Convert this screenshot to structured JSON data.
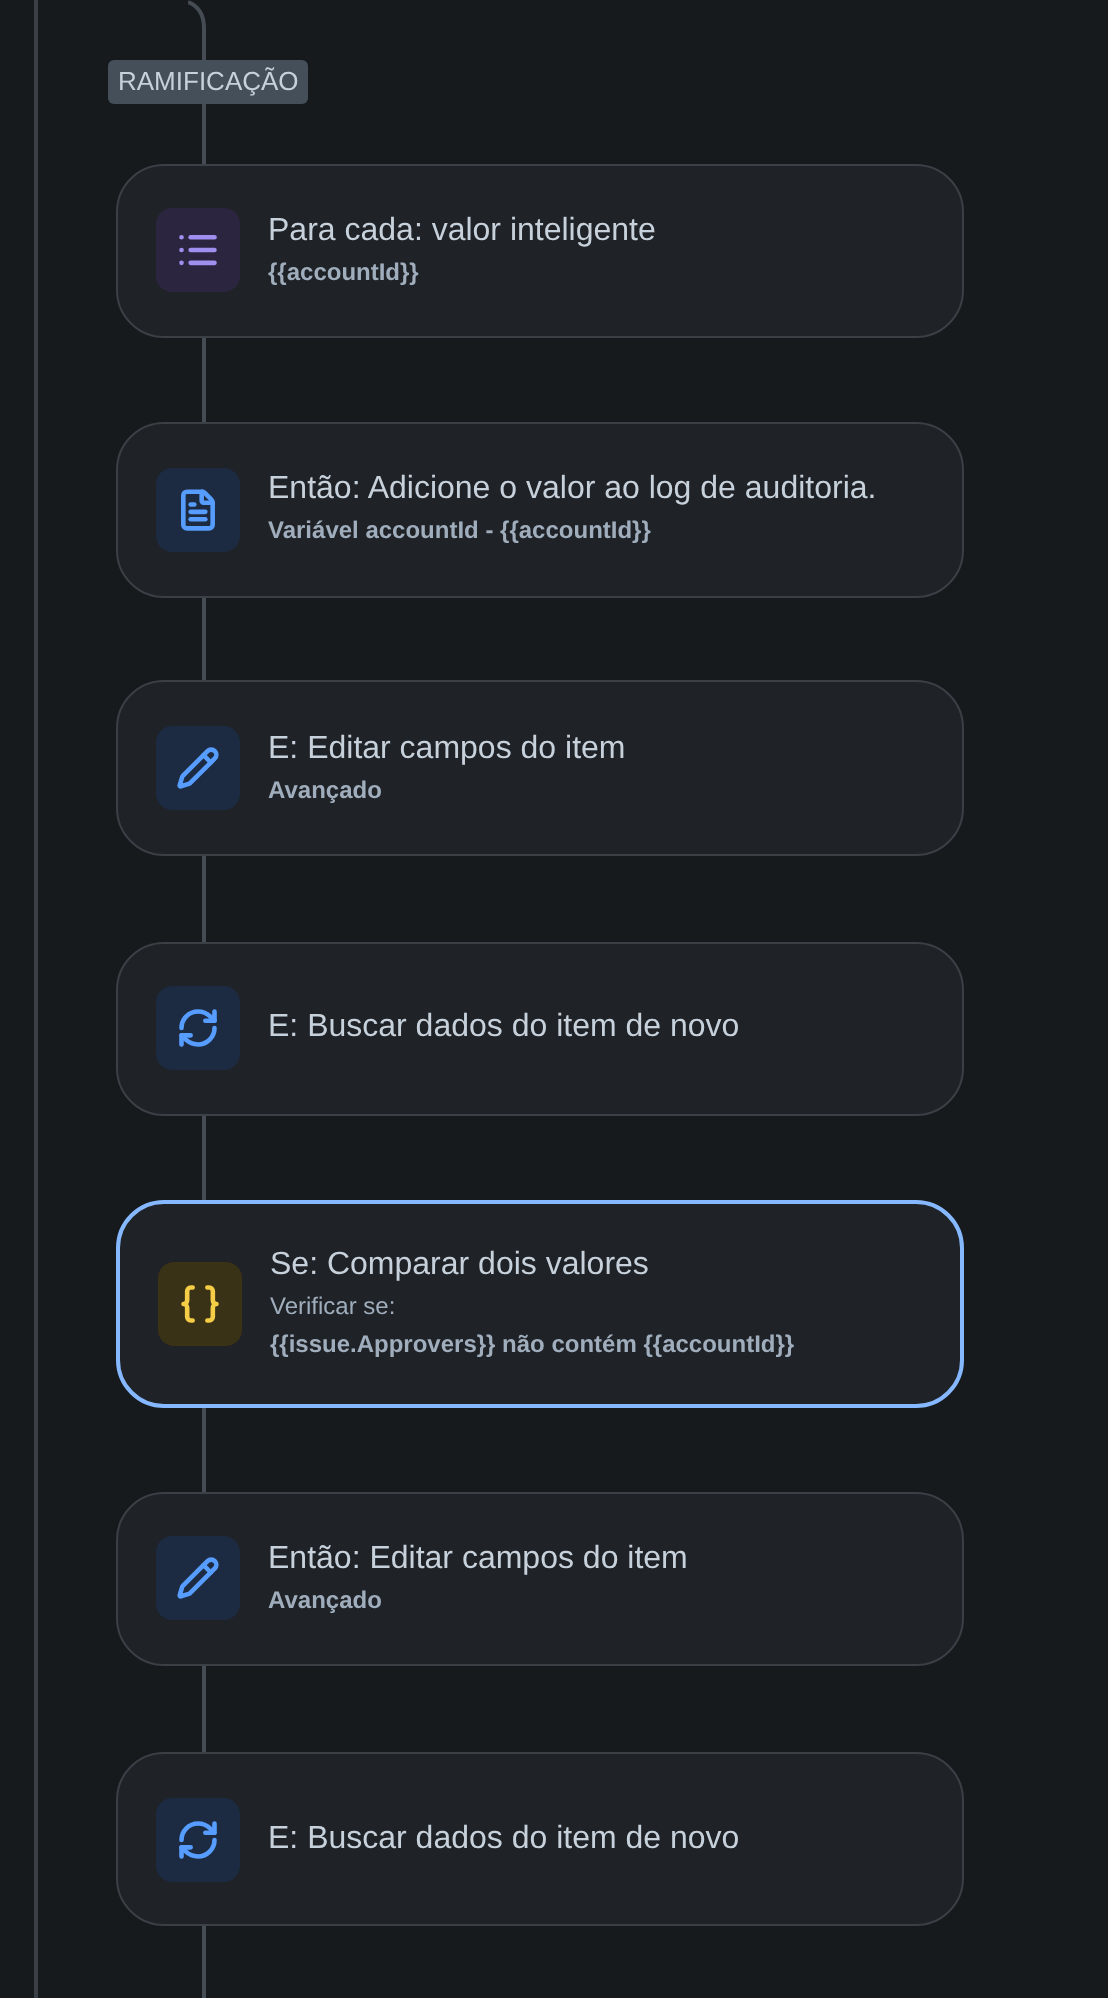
{
  "branch_label": "RAMIFICAÇÃO",
  "steps": [
    {
      "kind": "list",
      "title": "Para cada: valor inteligente",
      "lines": [
        {
          "text": "{{accountId}}",
          "bold": true
        }
      ],
      "selected": false
    },
    {
      "kind": "document",
      "title": "Então: Adicione o valor ao log de auditoria.",
      "lines": [
        {
          "text": "Variável accountId - {{accountId}}",
          "bold": true
        }
      ],
      "selected": false
    },
    {
      "kind": "pencil",
      "title": "E: Editar campos do item",
      "lines": [
        {
          "text": "Avançado",
          "bold": true
        }
      ],
      "selected": false
    },
    {
      "kind": "refresh",
      "title": "E: Buscar dados do item de novo",
      "selected": false
    },
    {
      "kind": "braces",
      "title": "Se: Comparar dois valores",
      "lines": [
        {
          "text": "Verificar se:",
          "bold": false
        },
        {
          "text": "{{issue.Approvers}} não contém {{accountId}}",
          "bold": true
        }
      ],
      "selected": true
    },
    {
      "kind": "pencil",
      "title": "Então: Editar campos do item",
      "lines": [
        {
          "text": "Avançado",
          "bold": true
        }
      ],
      "selected": false
    },
    {
      "kind": "refresh",
      "title": "E: Buscar dados do item de novo",
      "selected": false
    }
  ]
}
